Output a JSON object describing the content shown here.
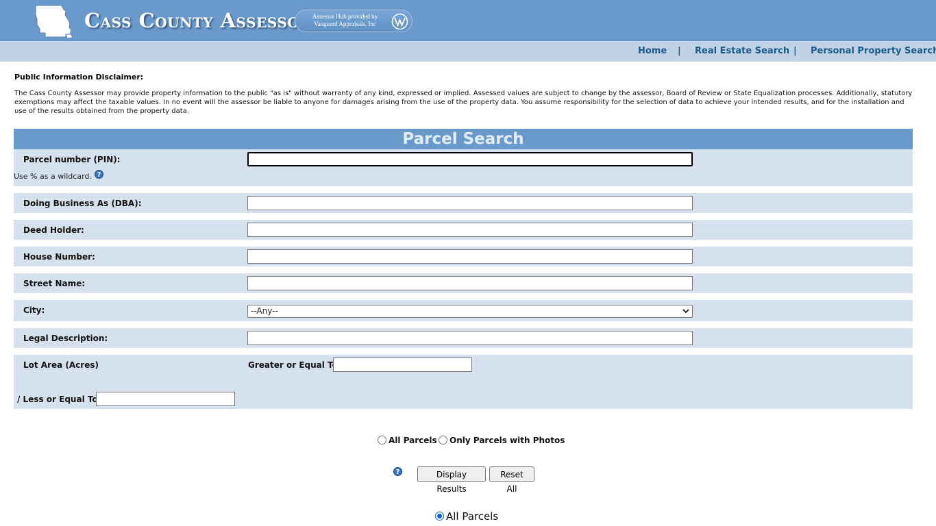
{
  "header": {
    "title": "Cass County Assessor",
    "provider_line1": "Assessor Hub provided by",
    "provider_line2": "Vanguard Appraisals, Inc"
  },
  "nav": {
    "home": "Home",
    "real_estate": "Real Estate Search",
    "personal_property": "Personal Property Search",
    "separator": "|"
  },
  "disclaimer": {
    "title": "Public Information Disclaimer:",
    "body": "The Cass County Assessor may provide property information to the public \"as is\" without warranty of any kind, expressed or implied. Assessed values are subject to change by the assessor, Board of Review or State Equalization processes. Additionally, statutory exemptions may affect the taxable values. In no event will the assessor be liable to anyone for damages arising from the use of the property data. You assume responsibility for the selection of data to achieve your intended results, and for the installation and use of the results obtained from the property data."
  },
  "search": {
    "title": "Parcel Search",
    "pin_label": "Parcel number (PIN):",
    "pin_value": "",
    "wildcard_hint": "Use % as a wildcard.",
    "dba_label": "Doing Business As (DBA):",
    "dba_value": "",
    "deed_label": "Deed Holder:",
    "deed_value": "",
    "house_label": "House Number:",
    "house_value": "",
    "street_label": "Street Name:",
    "street_value": "",
    "city_label": "City:",
    "city_selected": "--Any--",
    "legal_label": "Legal Description:",
    "legal_value": "",
    "lot_label": "Lot Area (Acres)",
    "gte_label": "Greater or Equal To:",
    "gte_value": "",
    "lte_label": "/ Less or Equal To:",
    "lte_value": ""
  },
  "filters": {
    "all_parcels": "All Parcels",
    "photos_only": "Only Parcels with Photos",
    "selected": "none"
  },
  "buttons": {
    "display": "Display Results",
    "reset": "Reset All"
  },
  "bottom_radio": {
    "label": "All Parcels",
    "checked": true
  },
  "colors": {
    "banner": "#6a9acc",
    "navbar": "#c0d2e6",
    "row": "#d6e1ee",
    "nav_text": "#1a5a8a"
  },
  "icons": {
    "state": "missouri-state-icon",
    "vanguard": "vanguard-logo-icon",
    "help": "help-icon"
  }
}
